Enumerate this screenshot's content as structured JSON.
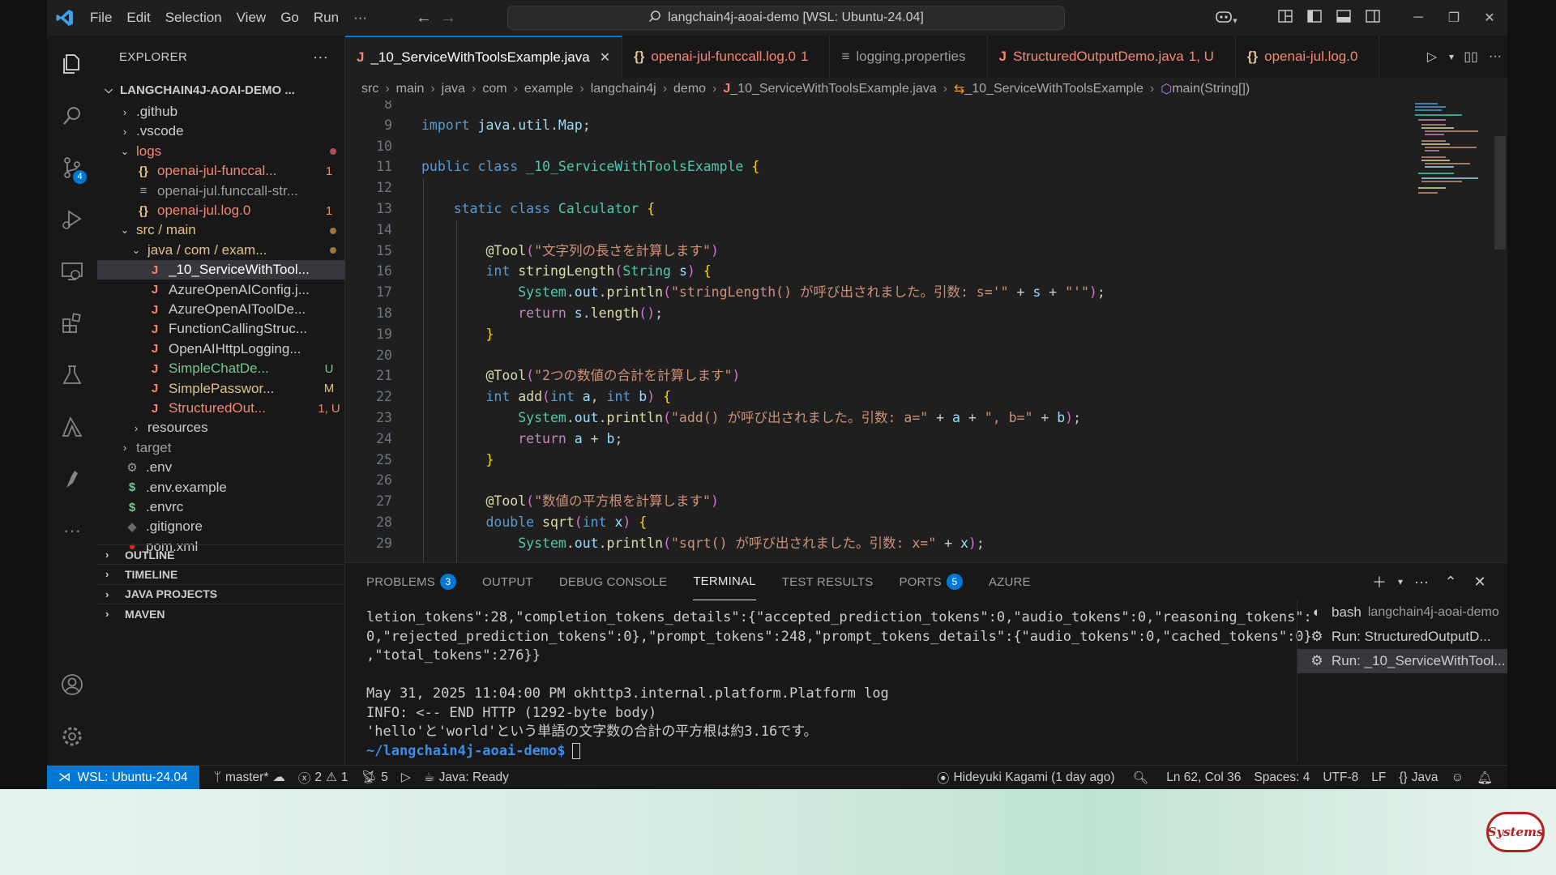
{
  "titlebar": {
    "menu": [
      "File",
      "Edit",
      "Selection",
      "View",
      "Go",
      "Run",
      "···"
    ],
    "search_text": "langchain4j-aoai-demo [WSL: Ubuntu-24.04]"
  },
  "sidebar": {
    "title": "EXPLORER",
    "root": "LANGCHAIN4J-AOAI-DEMO ...",
    "items": [
      {
        "name": ".github",
        "kind": "folder-closed",
        "indent": 1,
        "color": "#cccccc",
        "deco": ""
      },
      {
        "name": ".vscode",
        "kind": "folder-closed",
        "indent": 1,
        "color": "#cccccc",
        "deco": ""
      },
      {
        "name": "logs",
        "kind": "folder-open",
        "indent": 1,
        "color": "#f48771",
        "deco": "dot-red"
      },
      {
        "name": "openai-jul-funccal...",
        "kind": "json",
        "indent": 2,
        "color": "#f48771",
        "deco": "1"
      },
      {
        "name": "openai-jul.funccall-str...",
        "kind": "text",
        "indent": 2,
        "color": "#9d9d9d",
        "deco": ""
      },
      {
        "name": "openai-jul.log.0",
        "kind": "json",
        "indent": 2,
        "color": "#f48771",
        "deco": "1"
      },
      {
        "name": "src / main",
        "kind": "folder-open",
        "indent": 1,
        "color": "#e2c08d",
        "deco": "dot-yellow"
      },
      {
        "name": "java / com / exam...",
        "kind": "folder-open",
        "indent": 2,
        "color": "#e2c08d",
        "deco": "dot-yellow"
      },
      {
        "name": "_10_ServiceWithTool...",
        "kind": "java",
        "indent": 3,
        "color": "#ffffff",
        "deco": "",
        "selected": true
      },
      {
        "name": "AzureOpenAIConfig.j...",
        "kind": "java",
        "indent": 3,
        "color": "#cccccc",
        "deco": ""
      },
      {
        "name": "AzureOpenAIToolDe...",
        "kind": "java",
        "indent": 3,
        "color": "#cccccc",
        "deco": ""
      },
      {
        "name": "FunctionCallingStruc...",
        "kind": "java",
        "indent": 3,
        "color": "#cccccc",
        "deco": ""
      },
      {
        "name": "OpenAIHttpLogging...",
        "kind": "java",
        "indent": 3,
        "color": "#cccccc",
        "deco": ""
      },
      {
        "name": "SimpleChatDe...",
        "kind": "java",
        "indent": 3,
        "color": "#73c991",
        "deco": "U"
      },
      {
        "name": "SimplePasswor...",
        "kind": "java",
        "indent": 3,
        "color": "#e2c08d",
        "deco": "M"
      },
      {
        "name": "StructuredOut...",
        "kind": "java",
        "indent": 3,
        "color": "#f48771",
        "deco": "1, U"
      },
      {
        "name": "resources",
        "kind": "folder-closed",
        "indent": 2,
        "color": "#cccccc",
        "deco": ""
      },
      {
        "name": "target",
        "kind": "folder-closed",
        "indent": 1,
        "color": "#9d9d9d",
        "deco": ""
      },
      {
        "name": ".env",
        "kind": "gear",
        "indent": 1,
        "color": "#cccccc",
        "deco": ""
      },
      {
        "name": ".env.example",
        "kind": "dollar",
        "indent": 1,
        "color": "#cccccc",
        "deco": ""
      },
      {
        "name": ".envrc",
        "kind": "dollar",
        "indent": 1,
        "color": "#cccccc",
        "deco": ""
      },
      {
        "name": ".gitignore",
        "kind": "diamond",
        "indent": 1,
        "color": "#cccccc",
        "deco": ""
      },
      {
        "name": "pom.xml",
        "kind": "maven",
        "indent": 1,
        "color": "#cccccc",
        "deco": ""
      }
    ],
    "sections": [
      "OUTLINE",
      "TIMELINE",
      "JAVA PROJECTS",
      "MAVEN"
    ],
    "scm_badge": "4"
  },
  "tabs": [
    {
      "label": "_10_ServiceWithToolsExample.java",
      "icon": "J",
      "icon_color": "#f48771",
      "color": "#ffffff",
      "suffix": "",
      "active": true
    },
    {
      "label": "openai-jul-funccall.log.0",
      "icon": "{}",
      "icon_color": "#e2c08d",
      "color": "#f48771",
      "suffix": "1",
      "active": false
    },
    {
      "label": "logging.properties",
      "icon": "≡",
      "icon_color": "#9d9d9d",
      "color": "#9d9d9d",
      "suffix": "",
      "active": false
    },
    {
      "label": "StructuredOutputDemo.java",
      "icon": "J",
      "icon_color": "#f48771",
      "color": "#f48771",
      "suffix": "1, U",
      "active": false
    },
    {
      "label": "openai-jul.log.0",
      "icon": "{}",
      "icon_color": "#e2c08d",
      "color": "#f48771",
      "suffix": "",
      "active": false
    }
  ],
  "breadcrumb": [
    "src",
    "main",
    "java",
    "com",
    "example",
    "langchain4j",
    "demo",
    "_10_ServiceWithToolsExample.java",
    "_10_ServiceWithToolsExample",
    "main(String[])"
  ],
  "code": [
    {
      "n": "8",
      "t": ""
    },
    {
      "n": "9",
      "t": "import java.util.Map;"
    },
    {
      "n": "10",
      "t": ""
    },
    {
      "n": "11",
      "t": "public class _10_ServiceWithToolsExample {"
    },
    {
      "n": "12",
      "t": ""
    },
    {
      "n": "13",
      "t": "    static class Calculator {"
    },
    {
      "n": "14",
      "t": ""
    },
    {
      "n": "15",
      "t": "        @Tool(\"文字列の長さを計算します\")"
    },
    {
      "n": "16",
      "t": "        int stringLength(String s) {"
    },
    {
      "n": "17",
      "t": "            System.out.println(\"stringLength() が呼び出されました。引数: s='\" + s + \"'\");"
    },
    {
      "n": "18",
      "t": "            return s.length();"
    },
    {
      "n": "19",
      "t": "        }"
    },
    {
      "n": "20",
      "t": ""
    },
    {
      "n": "21",
      "t": "        @Tool(\"2つの数値の合計を計算します\")"
    },
    {
      "n": "22",
      "t": "        int add(int a, int b) {"
    },
    {
      "n": "23",
      "t": "            System.out.println(\"add() が呼び出されました。引数: a=\" + a + \", b=\" + b);"
    },
    {
      "n": "24",
      "t": "            return a + b;"
    },
    {
      "n": "25",
      "t": "        }"
    },
    {
      "n": "26",
      "t": ""
    },
    {
      "n": "27",
      "t": "        @Tool(\"数値の平方根を計算します\")"
    },
    {
      "n": "28",
      "t": "        double sqrt(int x) {"
    },
    {
      "n": "29",
      "t": "            System.out.println(\"sqrt() が呼び出されました。引数: x=\" + x);"
    }
  ],
  "panel": {
    "tabs": [
      {
        "label": "PROBLEMS",
        "badge": "3"
      },
      {
        "label": "OUTPUT",
        "badge": ""
      },
      {
        "label": "DEBUG CONSOLE",
        "badge": ""
      },
      {
        "label": "TERMINAL",
        "badge": "",
        "active": true
      },
      {
        "label": "TEST RESULTS",
        "badge": ""
      },
      {
        "label": "PORTS",
        "badge": "5"
      },
      {
        "label": "AZURE",
        "badge": ""
      }
    ],
    "terminal_lines": [
      "letion_tokens\":28,\"completion_tokens_details\":{\"accepted_prediction_tokens\":0,\"audio_tokens\":0,\"reasoning_tokens\":",
      "0,\"rejected_prediction_tokens\":0},\"prompt_tokens\":248,\"prompt_tokens_details\":{\"audio_tokens\":0,\"cached_tokens\":0}",
      ",\"total_tokens\":276}}",
      "",
      "May 31, 2025 11:04:00 PM okhttp3.internal.platform.Platform log",
      "INFO: <-- END HTTP (1292-byte body)",
      "'hello'と'world'という単語の文字数の合計の平方根は約3.16です。"
    ],
    "prompt": "~/langchain4j-aoai-demo$",
    "terminals": [
      {
        "icon": "bash",
        "label": "bash",
        "sub": "langchain4j-aoai-demo",
        "selected": false
      },
      {
        "icon": "run",
        "label": "Run: StructuredOutputD...",
        "sub": "",
        "selected": false
      },
      {
        "icon": "run",
        "label": "Run: _10_ServiceWithTool...",
        "sub": "",
        "selected": true
      }
    ]
  },
  "status": {
    "remote": "WSL: Ubuntu-24.04",
    "branch": "master*",
    "errors": "2",
    "warnings": "1",
    "ports": "5",
    "java": "Java: Ready",
    "blame": "Hideyuki Kagami (1 day ago)",
    "position": "Ln 62, Col 36",
    "spaces": "Spaces: 4",
    "encoding": "UTF-8",
    "eol": "LF",
    "language": "Java"
  },
  "desktop_logo_text": "Systems"
}
